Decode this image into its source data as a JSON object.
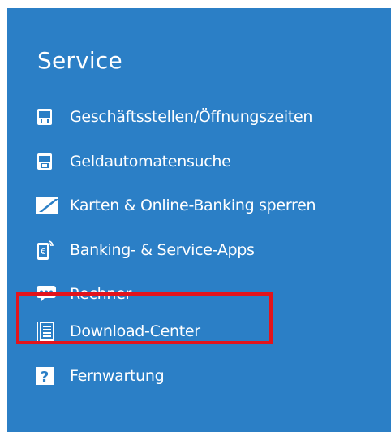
{
  "service": {
    "title": "Service",
    "items": [
      {
        "label": "Geschäftsstellen/Öffnungszeiten",
        "icon": "branch-icon"
      },
      {
        "label": "Geldautomatensuche",
        "icon": "atm-icon"
      },
      {
        "label": "Karten & Online-Banking sperren",
        "icon": "block-card-icon"
      },
      {
        "label": "Banking- & Service-Apps",
        "icon": "mobile-app-icon"
      },
      {
        "label": "Rechner",
        "icon": "chat-calculator-icon"
      },
      {
        "label": "Download-Center",
        "icon": "document-icon"
      },
      {
        "label": "Fernwartung",
        "icon": "question-icon"
      }
    ],
    "highlighted_item": "Download-Center"
  },
  "colors": {
    "panel_background": "#2b7fc6",
    "text": "#ffffff",
    "highlight_border": "#e3141c"
  }
}
